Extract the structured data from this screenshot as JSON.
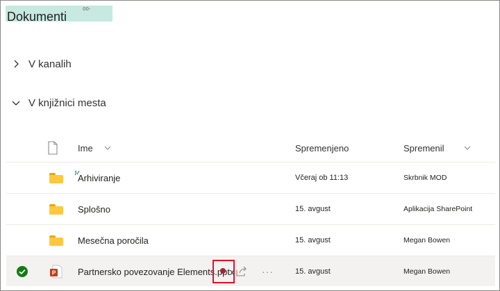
{
  "header": {
    "title": "Dokumenti",
    "tag": "00-"
  },
  "sections": [
    {
      "label": "V kanalih",
      "expanded": false
    },
    {
      "label": "V knjižnici mesta",
      "expanded": true
    }
  ],
  "table": {
    "columns": {
      "name": "Ime",
      "modified": "Spremenjeno",
      "modified_by": "Spremenil"
    },
    "rows": [
      {
        "type": "folder",
        "name": "Arhiviranje",
        "modified": "Včeraj ob 11:13",
        "modified_by": "Skrbnik MOD",
        "selected": false,
        "is_new": true
      },
      {
        "type": "folder",
        "name": "Splošno",
        "modified": "15. avgust",
        "modified_by": "Aplikacija SharePoint",
        "selected": false
      },
      {
        "type": "folder",
        "name": "Mesečna poročila",
        "modified": "15. avgust",
        "modified_by": "Megan Bowen",
        "selected": false
      },
      {
        "type": "pptx",
        "name": "Partnersko povezovanje Elements.pptx",
        "modified": "15. avgust",
        "modified_by": "Megan Bowen",
        "selected": true
      }
    ]
  },
  "icons": {
    "folder": "folder-icon",
    "pptx": "powerpoint-file-icon",
    "document_column": "document-icon",
    "share": "share-icon",
    "more": "more-icon",
    "check": "checkmark-circle-icon"
  },
  "colors": {
    "title_highlight": "#c7e9e0",
    "selection_row": "#f3f2f1",
    "check_green": "#107c10",
    "ppt_orange": "#c43e1c",
    "folder_yellow": "#ffc83d",
    "highlight_red": "#e81123"
  }
}
